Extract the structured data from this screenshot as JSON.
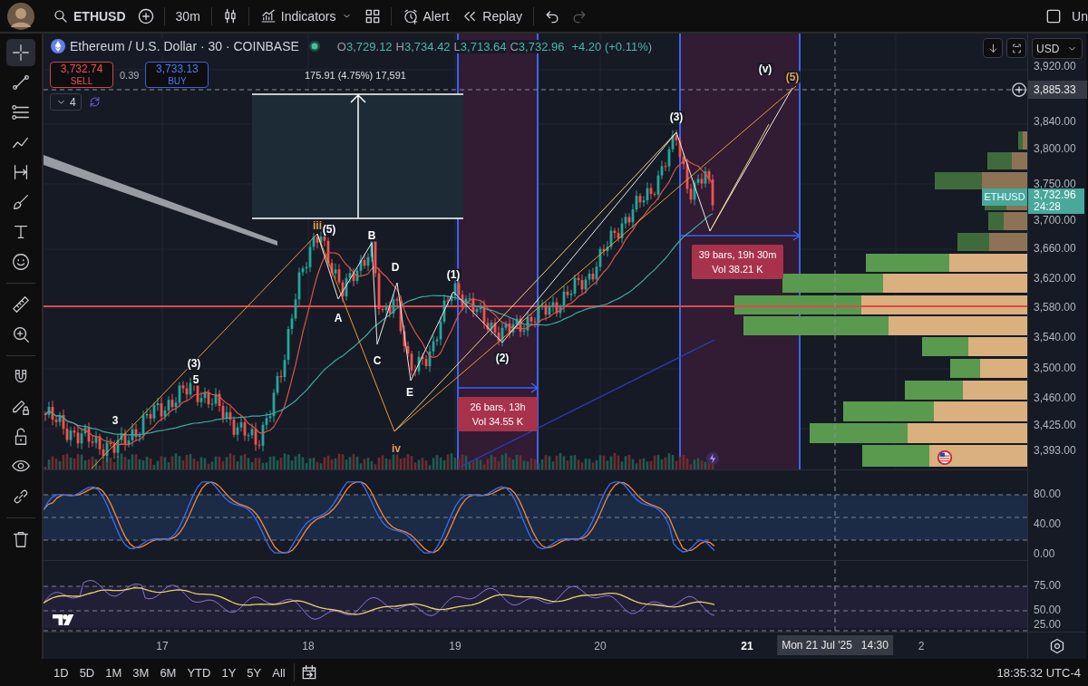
{
  "top_bar": {
    "symbol": "ETHUSD",
    "interval": "30m",
    "indicators": "Indicators",
    "alert": "Alert",
    "replay": "Replay",
    "account": "Un"
  },
  "tool_groups": [
    [
      {
        "kind": "crosshair",
        "selected": true
      },
      {
        "kind": "trendline",
        "selected": false
      },
      {
        "kind": "fib",
        "selected": false
      },
      {
        "kind": "pattern",
        "selected": false
      },
      {
        "kind": "measure",
        "selected": false
      },
      {
        "kind": "brush",
        "selected": false
      },
      {
        "kind": "text",
        "selected": false
      },
      {
        "kind": "emoji",
        "selected": false
      }
    ],
    [
      {
        "kind": "ruler",
        "selected": false
      },
      {
        "kind": "zoom",
        "selected": false
      }
    ],
    [
      {
        "kind": "magnet",
        "selected": false
      },
      {
        "kind": "lockdraw",
        "selected": false
      },
      {
        "kind": "lock",
        "selected": false
      },
      {
        "kind": "eye",
        "selected": false
      },
      {
        "kind": "link",
        "selected": false
      }
    ],
    [
      {
        "kind": "trash",
        "selected": false
      }
    ]
  ],
  "legend": {
    "title": "Ethereum / U.S. Dollar · 30 · COINBASE",
    "ohlc": [
      {
        "label": "O",
        "value": "3,729.12"
      },
      {
        "label": "H",
        "value": "3,734.42"
      },
      {
        "label": "L",
        "value": "3,713.64"
      },
      {
        "label": "C",
        "value": "3,732.96"
      }
    ],
    "change": "+4.20 (+0.11%)"
  },
  "trade": {
    "sell_price": "3,732.74",
    "sell_label": "SELL",
    "spread": "0.39",
    "buy_price": "3,733.13",
    "buy_label": "BUY"
  },
  "indicators_count": "4",
  "measure_label": "175.91 (4.75%) 17,591",
  "wave_labels": [
    {
      "text": "(5)",
      "color": "#ffffff"
    },
    {
      "text": "B",
      "color": "#ffffff"
    },
    {
      "text": "D",
      "color": "#ffffff"
    },
    {
      "text": "(1)",
      "color": "#ffffff"
    },
    {
      "text": "A",
      "color": "#ffffff"
    },
    {
      "text": "C",
      "color": "#ffffff"
    },
    {
      "text": "E",
      "color": "#ffffff"
    },
    {
      "text": "(2)",
      "color": "#ffffff"
    },
    {
      "text": "(3)",
      "color": "#ffffff"
    },
    {
      "text": "(3)",
      "color": "#ffffff"
    },
    {
      "text": "5",
      "color": "#ffffff"
    },
    {
      "text": "3",
      "color": "#ffffff"
    },
    {
      "text": "iii",
      "color": "#e8a04c"
    },
    {
      "text": "iv",
      "color": "#e8a04c"
    },
    {
      "text": "(v)",
      "color": "#ffffff"
    },
    {
      "text": "(5)",
      "color": "#e8a04c"
    }
  ],
  "ranges": [
    {
      "bars": "26 bars, 13h",
      "vol": "Vol 34.55 K"
    },
    {
      "bars": "39 bars, 19h 30m",
      "vol": "Vol 38.21 K"
    }
  ],
  "price_axis": {
    "currency": "USD",
    "labels": [
      "3,920.00",
      "3,840.00",
      "3,800.00",
      "3,750.00",
      "3,700.00",
      "3,660.00",
      "3,620.00",
      "3,580.00",
      "3,540.00",
      "3,500.00",
      "3,460.00",
      "3,425.00",
      "3,393.00"
    ],
    "crosshair_price": "3,885.33",
    "last": {
      "symbol": "ETHUSD",
      "price": "3,732.96",
      "countdown": "24:28"
    }
  },
  "stoch_axis": [
    "80.00",
    "40.00",
    "0.00"
  ],
  "rsi_axis": [
    "75.00",
    "50.00",
    "25.00"
  ],
  "time_axis": {
    "labels": [
      {
        "text": "17",
        "emphasized": false
      },
      {
        "text": "18",
        "emphasized": false
      },
      {
        "text": "19",
        "emphasized": false
      },
      {
        "text": "20",
        "emphasized": false
      },
      {
        "text": "21",
        "emphasized": true
      },
      {
        "text": "2",
        "emphasized": false
      }
    ],
    "crosshair_time": "Mon 21 Jul '25   14:30"
  },
  "bottom_bar": {
    "ranges": [
      "1D",
      "5D",
      "1M",
      "3M",
      "6M",
      "YTD",
      "1Y",
      "5Y",
      "All"
    ],
    "clock": "18:35:32 UTC-4"
  }
}
